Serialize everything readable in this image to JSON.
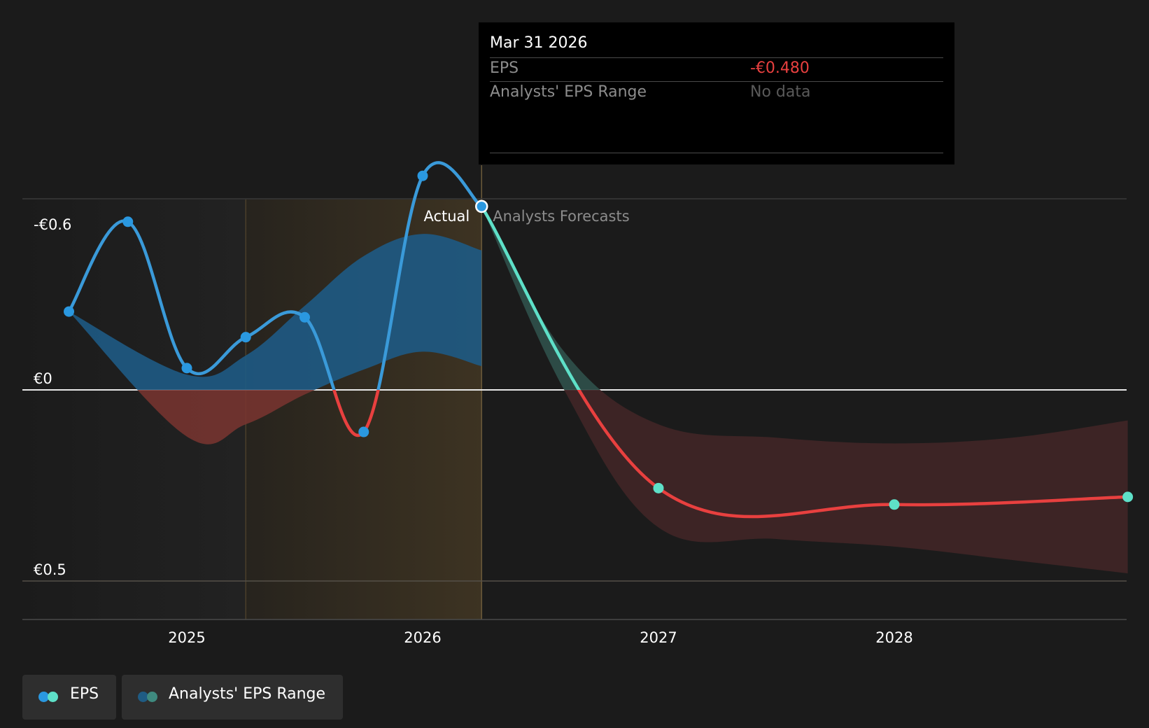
{
  "chart_data": {
    "type": "line",
    "y_axis": {
      "ticks": [
        "€0.5",
        "€0",
        "-€0.6"
      ],
      "tick_values": [
        0.5,
        0,
        -0.5
      ],
      "range": [
        -0.6,
        0.5
      ]
    },
    "x_axis": {
      "ticks": [
        "2025",
        "2026",
        "2027",
        "2028"
      ],
      "tick_values": [
        2025,
        2026,
        2027,
        2028
      ],
      "range": [
        2024.3,
        2028.99
      ]
    },
    "regions": {
      "actual_label": "Actual",
      "forecast_label": "Analysts Forecasts",
      "highlight_start": 2025.25,
      "divider": 2026.25
    },
    "series": [
      {
        "name": "EPS",
        "points": [
          {
            "x": 2024.5,
            "y": -0.205
          },
          {
            "x": 2024.75,
            "y": -0.44
          },
          {
            "x": 2025.0,
            "y": -0.057
          },
          {
            "x": 2025.25,
            "y": -0.138
          },
          {
            "x": 2025.5,
            "y": -0.19
          },
          {
            "x": 2025.75,
            "y": 0.11
          },
          {
            "x": 2026.0,
            "y": -0.56
          },
          {
            "x": 2026.25,
            "y": -0.48
          }
        ],
        "colors": {
          "negative": "#e8403f",
          "positive": "#3a9ad9",
          "marker": "#2a98e0"
        }
      },
      {
        "name": "EPS Forecast",
        "points": [
          {
            "x": 2026.25,
            "y": -0.48
          },
          {
            "x": 2027.0,
            "y": 0.257
          },
          {
            "x": 2028.0,
            "y": 0.3
          },
          {
            "x": 2028.99,
            "y": 0.28
          }
        ],
        "colors": {
          "negative": "#e8403f",
          "positive": "#5ee0c8",
          "marker": "#5ee0c8"
        }
      }
    ],
    "range_band_actual": {
      "x": [
        2024.5,
        2025.0,
        2025.25,
        2025.5,
        2025.75,
        2026.0,
        2026.25
      ],
      "high": [
        -0.205,
        0.122,
        0.09,
        0.012,
        -0.053,
        -0.1,
        -0.062
      ],
      "low": [
        -0.205,
        -0.04,
        -0.09,
        -0.22,
        -0.35,
        -0.408,
        -0.365
      ]
    },
    "range_band_forecast": {
      "x": [
        2026.25,
        2026.6,
        2027.0,
        2027.5,
        2028.0,
        2028.5,
        2028.99
      ],
      "high": [
        -0.48,
        0.0,
        0.36,
        0.39,
        0.41,
        0.445,
        0.48
      ],
      "low": [
        -0.48,
        -0.1,
        0.09,
        0.125,
        0.14,
        0.125,
        0.08
      ]
    },
    "colors": {
      "range_neg": "#7a3530",
      "range_pos": "#1e5a84",
      "range_forecast": "#2e4e49",
      "highlight": "#3d3322"
    },
    "highlighted_point": {
      "x": 2026.25,
      "y": -0.48
    }
  },
  "tooltip": {
    "date": "Mar 31 2026",
    "rows": [
      {
        "label": "EPS",
        "value": "-€0.480",
        "color": "#e8403f"
      },
      {
        "label": "Analysts' EPS Range",
        "value": "No data",
        "color": "#5a5a5a"
      }
    ]
  },
  "legend": [
    {
      "label": "EPS",
      "dot_colors": [
        "#2a98e0",
        "#5ee0c8"
      ]
    },
    {
      "label": "Analysts' EPS Range",
      "dot_colors": [
        "#1f5c84",
        "#3f8a7f"
      ]
    }
  ]
}
